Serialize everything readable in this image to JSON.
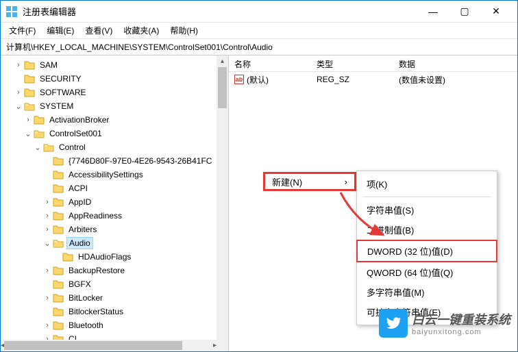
{
  "window": {
    "title": "注册表编辑器",
    "controls": {
      "min": "—",
      "max": "▢",
      "close": "✕"
    }
  },
  "menu": {
    "file": "文件(F)",
    "edit": "编辑(E)",
    "view": "查看(V)",
    "favorites": "收藏夹(A)",
    "help": "帮助(H)"
  },
  "address": "计算机\\HKEY_LOCAL_MACHINE\\SYSTEM\\ControlSet001\\Control\\Audio",
  "tree": {
    "sam": "SAM",
    "security": "SECURITY",
    "software": "SOFTWARE",
    "system": "SYSTEM",
    "activationbroker": "ActivationBroker",
    "controlset001": "ControlSet001",
    "control": "Control",
    "guid": "{7746D80F-97E0-4E26-9543-26B41FC",
    "accessibility": "AccessibilitySettings",
    "acpi": "ACPI",
    "appid": "AppID",
    "appreadiness": "AppReadiness",
    "arbiters": "Arbiters",
    "audio": "Audio",
    "hdaudioflags": "HDAudioFlags",
    "backuprestore": "BackupRestore",
    "bgfx": "BGFX",
    "bitlocker": "BitLocker",
    "bitlockerstatus": "BitlockerStatus",
    "bluetooth": "Bluetooth",
    "ci": "CI"
  },
  "list": {
    "headers": {
      "name": "名称",
      "type": "类型",
      "data": "数据"
    },
    "default_row": {
      "name": "(默认)",
      "type": "REG_SZ",
      "data": "(数值未设置)"
    }
  },
  "context": {
    "new": "新建(N)",
    "items": {
      "key": "项(K)",
      "string": "字符串值(S)",
      "binary": "二进制值(B)",
      "dword": "DWORD (32 位)值(D)",
      "qword": "QWORD (64 位)值(Q)",
      "multistring": "多字符串值(M)",
      "expandstring": "可扩充字符串值(E)"
    }
  },
  "icons": {
    "ab": "ab"
  },
  "watermark": {
    "main": "白云一键重装系统",
    "sub": "baiyunxitong.com"
  }
}
